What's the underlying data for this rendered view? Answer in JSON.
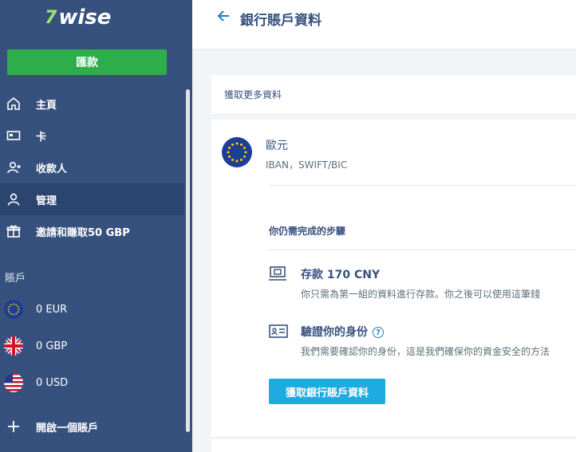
{
  "brand": {
    "flag": "7",
    "name": "wise"
  },
  "sidebar": {
    "send_label": "匯款",
    "nav": [
      {
        "label": "主頁",
        "icon": "home-icon"
      },
      {
        "label": "卡",
        "icon": "card-icon"
      },
      {
        "label": "收款人",
        "icon": "recipients-icon"
      },
      {
        "label": "管理",
        "icon": "user-icon",
        "active": true
      },
      {
        "label": "邀請和賺取50 GBP",
        "icon": "gift-icon"
      }
    ],
    "accounts_label": "賬戶",
    "accounts": [
      {
        "label": "0 EUR",
        "flag": "eu-flag-icon"
      },
      {
        "label": "0 GBP",
        "flag": "uk-flag-icon"
      },
      {
        "label": "0 USD",
        "flag": "us-flag-icon"
      }
    ],
    "open_account_label": "開啟一個賬戶"
  },
  "header": {
    "title": "銀行賬戶資料"
  },
  "main": {
    "get_more_label": "獲取更多資料",
    "currency": {
      "name": "歐元",
      "details": "IBAN，SWIFT/BIC"
    },
    "steps_title": "你仍需完成的步驟",
    "steps": [
      {
        "title": "存款 170 CNY",
        "desc": "你只需為第一組的資料進行存款。你之後可以使用這筆錢",
        "icon": "deposit-icon"
      },
      {
        "title": "驗證你的身份",
        "desc": "我們需要確認你的身份，這是我們確保你的資金安全的方法",
        "icon": "id-card-icon",
        "help": "?"
      }
    ],
    "cta_label": "獲取銀行賬戶資料"
  },
  "colors": {
    "sidebar": "#37517e",
    "send": "#2ead4b",
    "cta": "#1eabe0",
    "accent": "#1f7fbd"
  }
}
